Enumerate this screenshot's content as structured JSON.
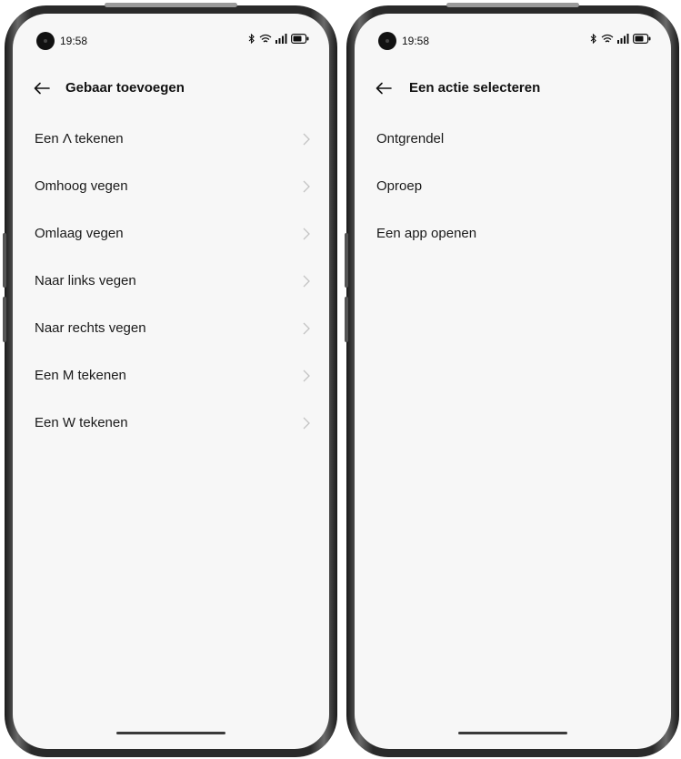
{
  "left_screen": {
    "status": {
      "time": "19:58"
    },
    "header": {
      "title": "Gebaar toevoegen"
    },
    "items": [
      {
        "label": "Een Λ tekenen"
      },
      {
        "label": "Omhoog vegen"
      },
      {
        "label": "Omlaag vegen"
      },
      {
        "label": "Naar links vegen"
      },
      {
        "label": "Naar rechts vegen"
      },
      {
        "label": "Een M tekenen"
      },
      {
        "label": "Een W tekenen"
      }
    ]
  },
  "right_screen": {
    "status": {
      "time": "19:58"
    },
    "header": {
      "title": "Een actie selecteren"
    },
    "items": [
      {
        "label": "Ontgrendel"
      },
      {
        "label": "Oproep"
      },
      {
        "label": "Een app openen"
      }
    ]
  },
  "icons": {
    "back": "back-arrow-icon",
    "chevron": "chevron-right-icon",
    "status": [
      "bluetooth-icon",
      "wifi-icon",
      "signal-icon",
      "battery-icon"
    ]
  },
  "colors": {
    "screen_background": "#f7f7f7",
    "text": "#1a1a1a",
    "chevron": "#c4c4c4",
    "frame": "#2a2a2a"
  }
}
